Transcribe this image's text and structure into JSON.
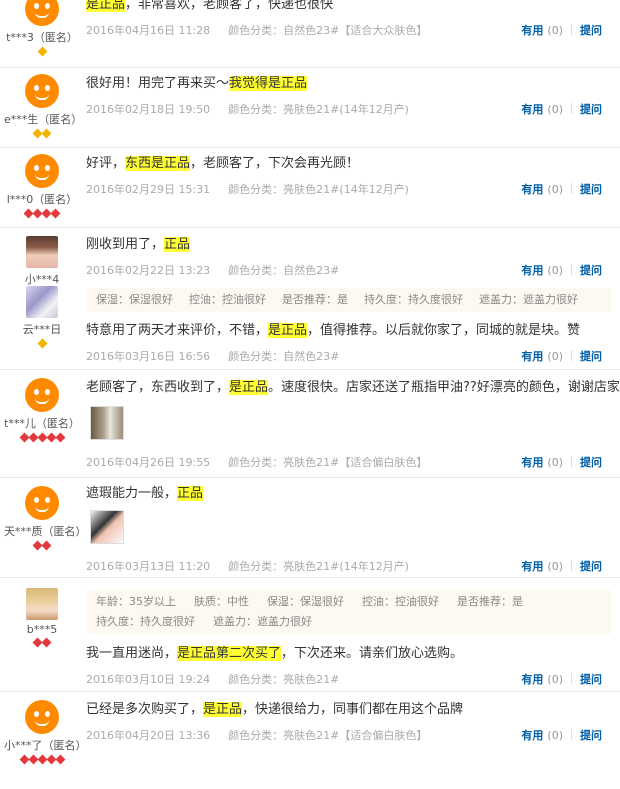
{
  "reviews": [
    {
      "user": "t***3（匿名）",
      "badges": [
        "gold"
      ],
      "content": {
        "before": "",
        "hl1": "是正品",
        "mid": "，非常喜欢，老顾客了，快递也很快",
        "hl2": "",
        "after": ""
      },
      "date": "2016年04月16日 11:28",
      "sku": "颜色分类：自然色23#【适合大众肤色】",
      "useful": "有用",
      "count": "(0)",
      "reply": "提问"
    },
    {
      "user": "e***生（匿名）",
      "badges": [
        "gold",
        "gold"
      ],
      "content": {
        "before": "很好用！用完了再来买～",
        "hl1": "我觉得是正品",
        "after": ""
      },
      "date": "2016年02月18日 19:50",
      "sku": "颜色分类：亮肤色21#(14年12月产)",
      "useful": "有用",
      "count": "(0)",
      "reply": "提问"
    },
    {
      "user": "l***0（匿名）",
      "badges": [
        "red",
        "red",
        "red",
        "red"
      ],
      "content": {
        "before": "好评，",
        "hl1": "东西是正品",
        "after": "，老顾客了，下次会再光顾！"
      },
      "date": "2016年02月29日 15:31",
      "sku": "颜色分类：亮肤色21#(14年12月产)",
      "useful": "有用",
      "count": "(0)",
      "reply": "提问"
    },
    {
      "user": "小***4",
      "user2": "云***日",
      "badges2": [
        "gold"
      ],
      "content": {
        "before": "刚收到用了，",
        "hl1": "正品",
        "after": ""
      },
      "date": "2016年02月22日 13:23",
      "sku": "颜色分类：自然色23#",
      "useful": "有用",
      "count": "(0)",
      "reply": "提问",
      "tags": [
        "保湿：保湿很好",
        "控油：控油很好",
        "是否推荐：是",
        "持久度：持久度很好",
        "遮盖力：遮盖力很好"
      ],
      "content2": {
        "before": "特意用了两天才来评价，不错，",
        "hl1": "是正品",
        "after": "，值得推荐。以后就你家了，同城的就是块。赞"
      },
      "date2": "2016年03月16日 16:56",
      "sku2": "颜色分类：自然色23#",
      "useful2": "有用",
      "count2": "(0)",
      "reply2": "提问"
    },
    {
      "user": "t***儿（匿名）",
      "badges": [
        "red",
        "red",
        "red",
        "red",
        "red"
      ],
      "content": {
        "before": "老顾客了，东西收到了，",
        "hl1": "是正品",
        "after": "。速度很快。店家还送了瓶指甲油??好漂亮的颜色，谢谢店家??"
      },
      "date": "2016年04月26日 19:55",
      "sku": "颜色分类：亮肤色21#【适合偏白肤色】",
      "useful": "有用",
      "count": "(0)",
      "reply": "提问"
    },
    {
      "user": "天***质（匿名）",
      "badges": [
        "red",
        "red"
      ],
      "content": {
        "before": "遮瑕能力一般，",
        "hl1": "正品",
        "after": ""
      },
      "date": "2016年03月13日 11:20",
      "sku": "颜色分类：亮肤色21#(14年12月产)",
      "useful": "有用",
      "count": "(0)",
      "reply": "提问"
    },
    {
      "user": "b***5",
      "badges": [
        "red",
        "red"
      ],
      "tags_row1": [
        "年龄：35岁以上",
        "肤质：中性",
        "保湿：保湿很好",
        "控油：控油很好",
        "是否推荐：是"
      ],
      "tags_row2": [
        "持久度：持久度很好",
        "遮盖力：遮盖力很好"
      ],
      "content": {
        "before": "我一直用迷尚，",
        "hl1": "是正品第二次买了",
        "after": "，下次还来。请亲们放心选购。"
      },
      "date": "2016年03月10日 19:24",
      "sku": "颜色分类：亮肤色21#",
      "useful": "有用",
      "count": "(0)",
      "reply": "提问"
    },
    {
      "user": "小***了（匿名）",
      "badges": [
        "red",
        "red",
        "red",
        "red",
        "red"
      ],
      "content": {
        "before": "已经是多次购买了，",
        "hl1": "是正品",
        "after": "，快递很给力，同事们都在用这个品牌"
      },
      "date": "2016年04月20日 13:36",
      "sku": "颜色分类：亮肤色21#【适合偏白肤色】",
      "useful": "有用",
      "count": "(0)",
      "reply": "提问"
    }
  ]
}
